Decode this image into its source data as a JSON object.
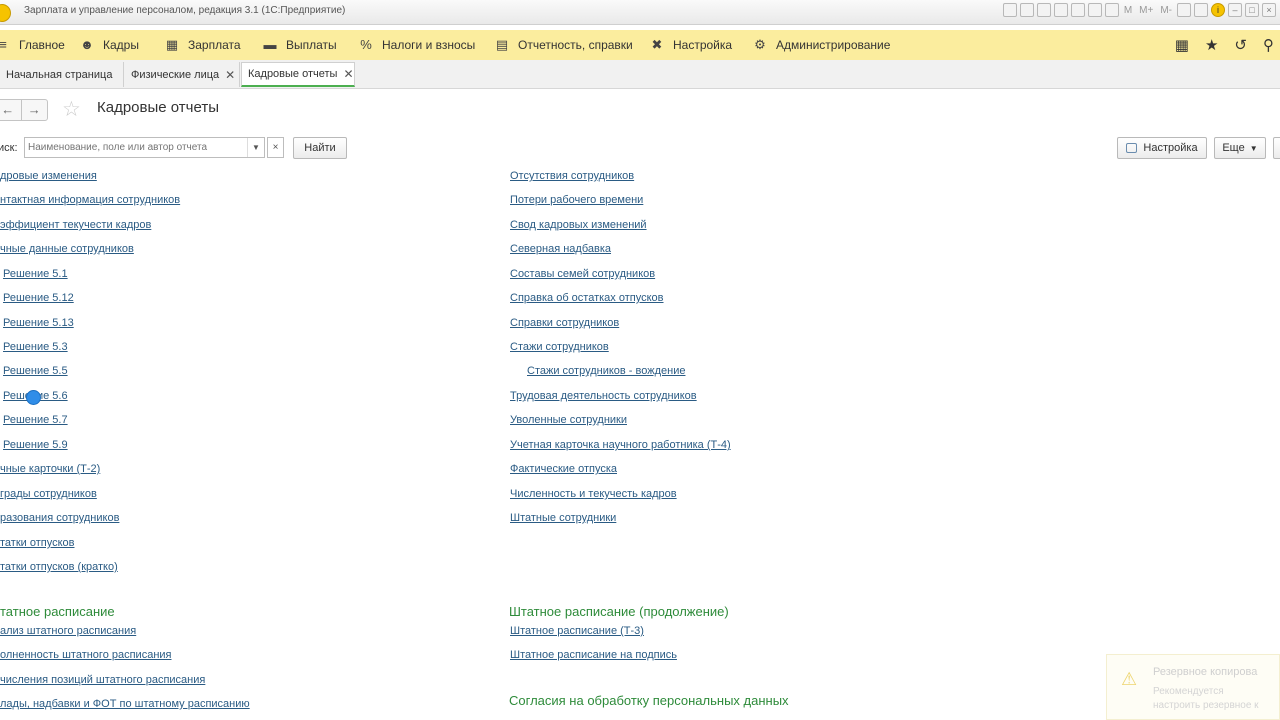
{
  "window": {
    "title": "Зарплата и управление персоналом, редакция 3.1  (1С:Предприятие)",
    "toolbar_labels": [
      "M",
      "M+",
      "M-",
      "i"
    ]
  },
  "main_menu": {
    "items": [
      {
        "label": "Главное",
        "icon": "hamburger-icon"
      },
      {
        "label": "Кадры",
        "icon": "people-icon"
      },
      {
        "label": "Зарплата",
        "icon": "calculator-icon"
      },
      {
        "label": "Выплаты",
        "icon": "money-icon"
      },
      {
        "label": "Налоги и взносы",
        "icon": "percent-icon"
      },
      {
        "label": "Отчетность, справки",
        "icon": "reports-icon"
      },
      {
        "label": "Настройка",
        "icon": "wrench-icon"
      },
      {
        "label": "Администрирование",
        "icon": "gear-icon"
      }
    ],
    "right_icons": [
      "grid-icon",
      "star-icon",
      "history-icon",
      "search-icon"
    ]
  },
  "tabs": [
    {
      "label": "Начальная страница",
      "closable": false
    },
    {
      "label": "Физические лица",
      "closable": true
    },
    {
      "label": "Кадровые отчеты",
      "closable": true,
      "active": true
    }
  ],
  "page": {
    "title": "Кадровые отчеты"
  },
  "search": {
    "label": "иск:",
    "placeholder": "Наименование, поле или автор отчета",
    "value": "",
    "find_label": "Найти",
    "clear_label": "×"
  },
  "buttons": {
    "settings_label": "Настройка",
    "more_label": "Еще"
  },
  "reports": {
    "left_links": [
      "дровые изменения",
      "нтактная информация сотрудников",
      "эффициент текучести кадров",
      "чные данные сотрудников",
      "Решение 5.1",
      "Решение 5.12",
      "Решение 5.13",
      "Решение 5.3",
      "Решение 5.5",
      "Решение 5.6",
      "Решение 5.7",
      "Решение 5.9",
      "чные карточки (Т-2)",
      "грады сотрудников",
      "разования сотрудников",
      "татки отпусков",
      "татки отпусков (кратко)"
    ],
    "right_links": [
      "Отсутствия сотрудников",
      "Потери рабочего времени",
      "Свод кадровых изменений",
      "Северная надбавка",
      "Составы семей сотрудников",
      "Справка об остатках отпусков",
      "Справки сотрудников",
      "Стажи сотрудников",
      "Стажи сотрудников - вождение",
      "Трудовая деятельность сотрудников",
      "Уволенные сотрудники",
      "Учетная карточка научного работника (Т-4)",
      "Фактические отпуска",
      "Численность и текучесть кадров",
      "Штатные сотрудники"
    ]
  },
  "staffing": {
    "left_heading": "татное расписание",
    "left_links": [
      "ализ штатного расписания",
      "олненность штатного расписания",
      "числения позиций штатного расписания",
      "лады, надбавки и ФОТ по штатному расписанию"
    ],
    "right_heading": "Штатное расписание (продолжение)",
    "right_links": [
      "Штатное расписание (Т-3)",
      "Штатное расписание на подпись"
    ],
    "consent_heading": "Согласия на обработку персональных данных"
  },
  "notification": {
    "title": "Резервное копирова",
    "line1": "Рекомендуется",
    "line2": "настроить резервное к"
  },
  "colors": {
    "menu_bg": "#fbed9e",
    "link": "#2a5b84",
    "section_heading": "#2e8b3a",
    "active_tab_underline": "#4caf50"
  }
}
